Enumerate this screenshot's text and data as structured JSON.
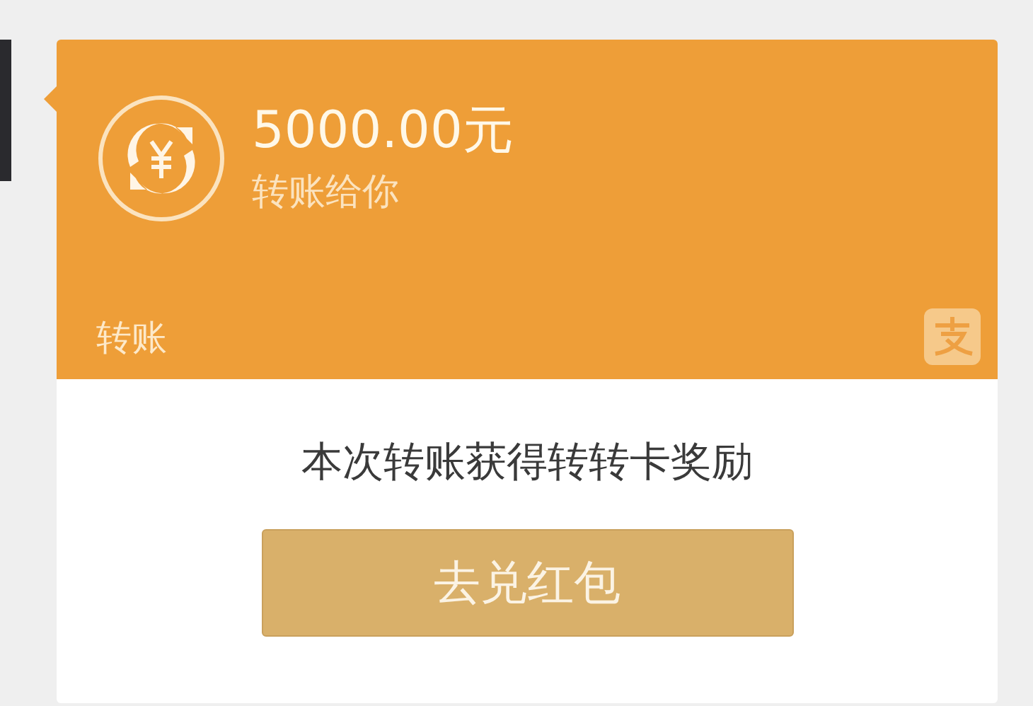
{
  "transfer_card": {
    "amount": "5000.00元",
    "note": "转账给你",
    "type_label": "转账"
  },
  "reward": {
    "message": "本次转账获得转转卡奖励",
    "button": "去兑红包"
  }
}
